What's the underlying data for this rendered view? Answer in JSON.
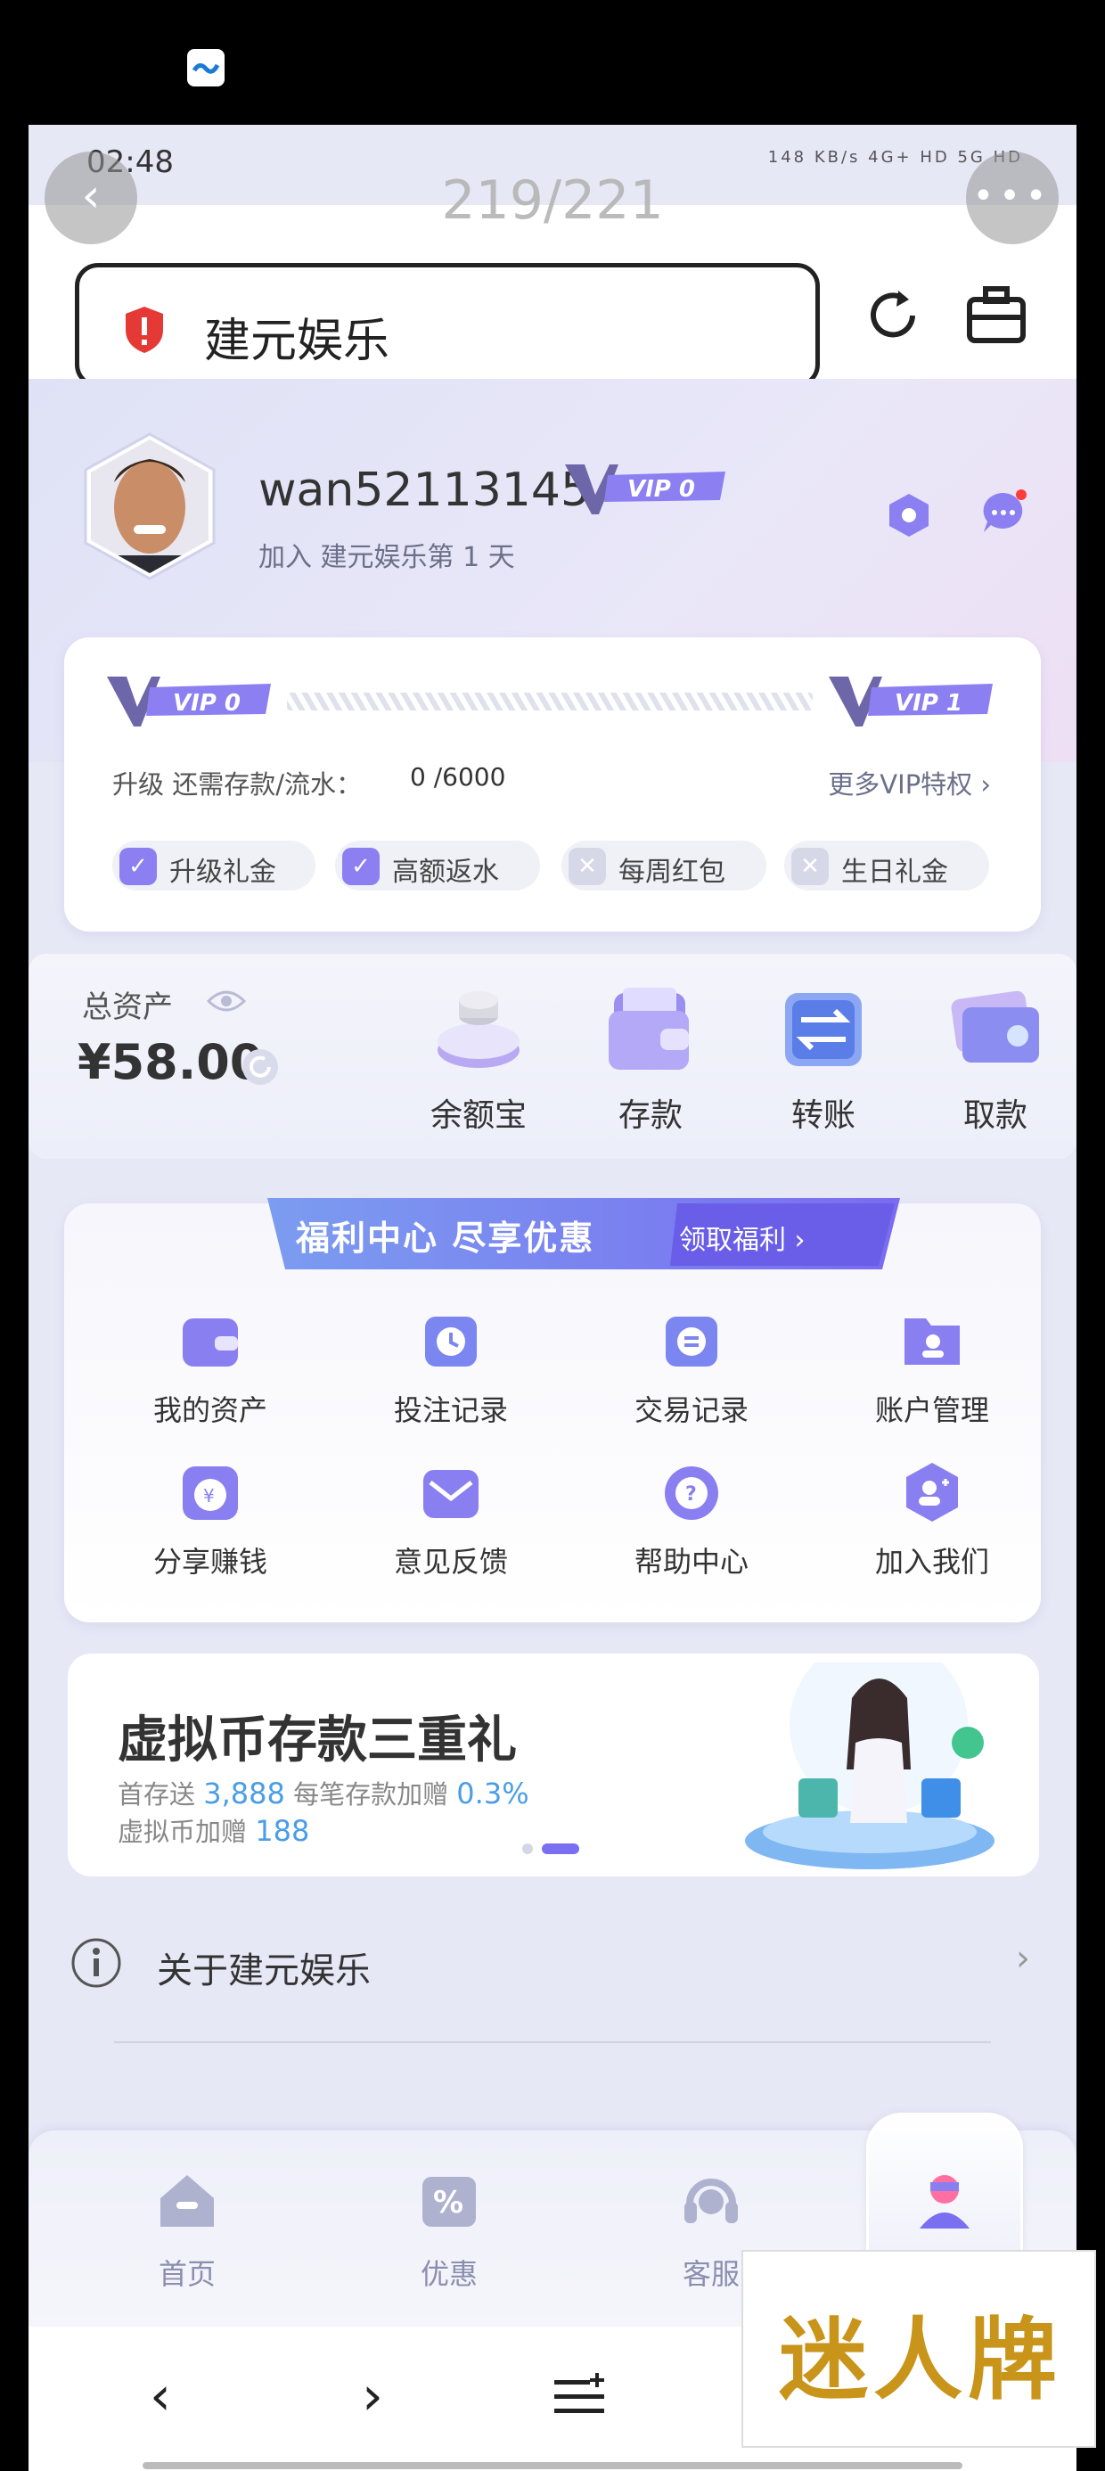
{
  "status_bar": {
    "time": "02:48",
    "indicators": "148 KB/s  4G+ HD  5G HD"
  },
  "browser": {
    "page_counter": "219/221",
    "url_text": "建元娱乐"
  },
  "profile": {
    "username": "wan52113145",
    "vip_badge": "VIP 0",
    "join_text": "加入 建元娱乐第 1 天"
  },
  "vip_card": {
    "start_level": "VIP 0",
    "end_level": "VIP 1",
    "upgrade_label": "升级 还需存款/流水：",
    "upgrade_value": "0 /6000",
    "progress": 0,
    "more_link": "更多VIP特权 ›",
    "perks": [
      {
        "label": "升级礼金",
        "active": true
      },
      {
        "label": "高额返水",
        "active": true
      },
      {
        "label": "每周红包",
        "active": false
      },
      {
        "label": "生日礼金",
        "active": false
      }
    ]
  },
  "assets": {
    "title": "总资产",
    "value": "¥58.00",
    "actions": [
      "余额宝",
      "存款",
      "转账",
      "取款"
    ]
  },
  "welfare": {
    "title": "福利中心 尽享优惠",
    "link": "领取福利 ›",
    "items": [
      "我的资产",
      "投注记录",
      "交易记录",
      "账户管理",
      "分享赚钱",
      "意见反馈",
      "帮助中心",
      "加入我们"
    ]
  },
  "promo": {
    "title": "虚拟币存款三重礼",
    "line1_prefix": "首存送",
    "line1_amount": "3,888",
    "line1_mid": "每笔存款加赠",
    "line1_pct": "0.3%",
    "line2_prefix": "虚拟币加赠",
    "line2_amount": "188"
  },
  "about": {
    "label": "关于建元娱乐",
    "chevron": "›"
  },
  "bottom_nav": {
    "items": [
      "首页",
      "优惠",
      "客服",
      "我的"
    ]
  },
  "watermark": {
    "text": "迷人牌"
  },
  "colors": {
    "accent": "#8b7ff2",
    "vip_purple": "#7a6ff0",
    "nav_gray": "#8a8fb0",
    "highlight_blue": "#4a9de6"
  }
}
